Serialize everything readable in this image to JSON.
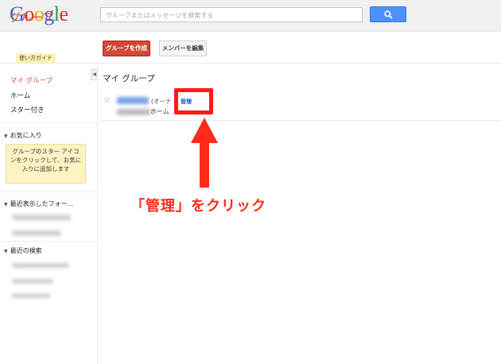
{
  "header": {
    "logo_letters": [
      "G",
      "o",
      "o",
      "g",
      "l",
      "e"
    ],
    "search_placeholder": "グループまたはメッセージを検索する",
    "search_button_icon": "search-icon"
  },
  "app": {
    "title": "グループ",
    "guide_label": "使い方ガイド",
    "create_group_label": "グループを作成",
    "edit_members_label": "メンバーを編集"
  },
  "sidebar": {
    "nav": [
      {
        "label": "マイ グループ",
        "active": true
      },
      {
        "label": "ホーム",
        "active": false
      },
      {
        "label": "スター付き",
        "active": false
      }
    ],
    "favorites_label": "お気に入り",
    "favorites_tip": "グループのスター アイコンをクリックして、お気に入りに追加します",
    "recent_label": "最近表示したフォー...",
    "recent_search_label": "最近の検索"
  },
  "main": {
    "title": "マイ グループ",
    "group_owner_label": "(オーナ",
    "manage_label": "管理",
    "home_suffix": "ホーム"
  },
  "annotation": {
    "text": "「管理」をクリック",
    "color": "#ff2a1a"
  }
}
